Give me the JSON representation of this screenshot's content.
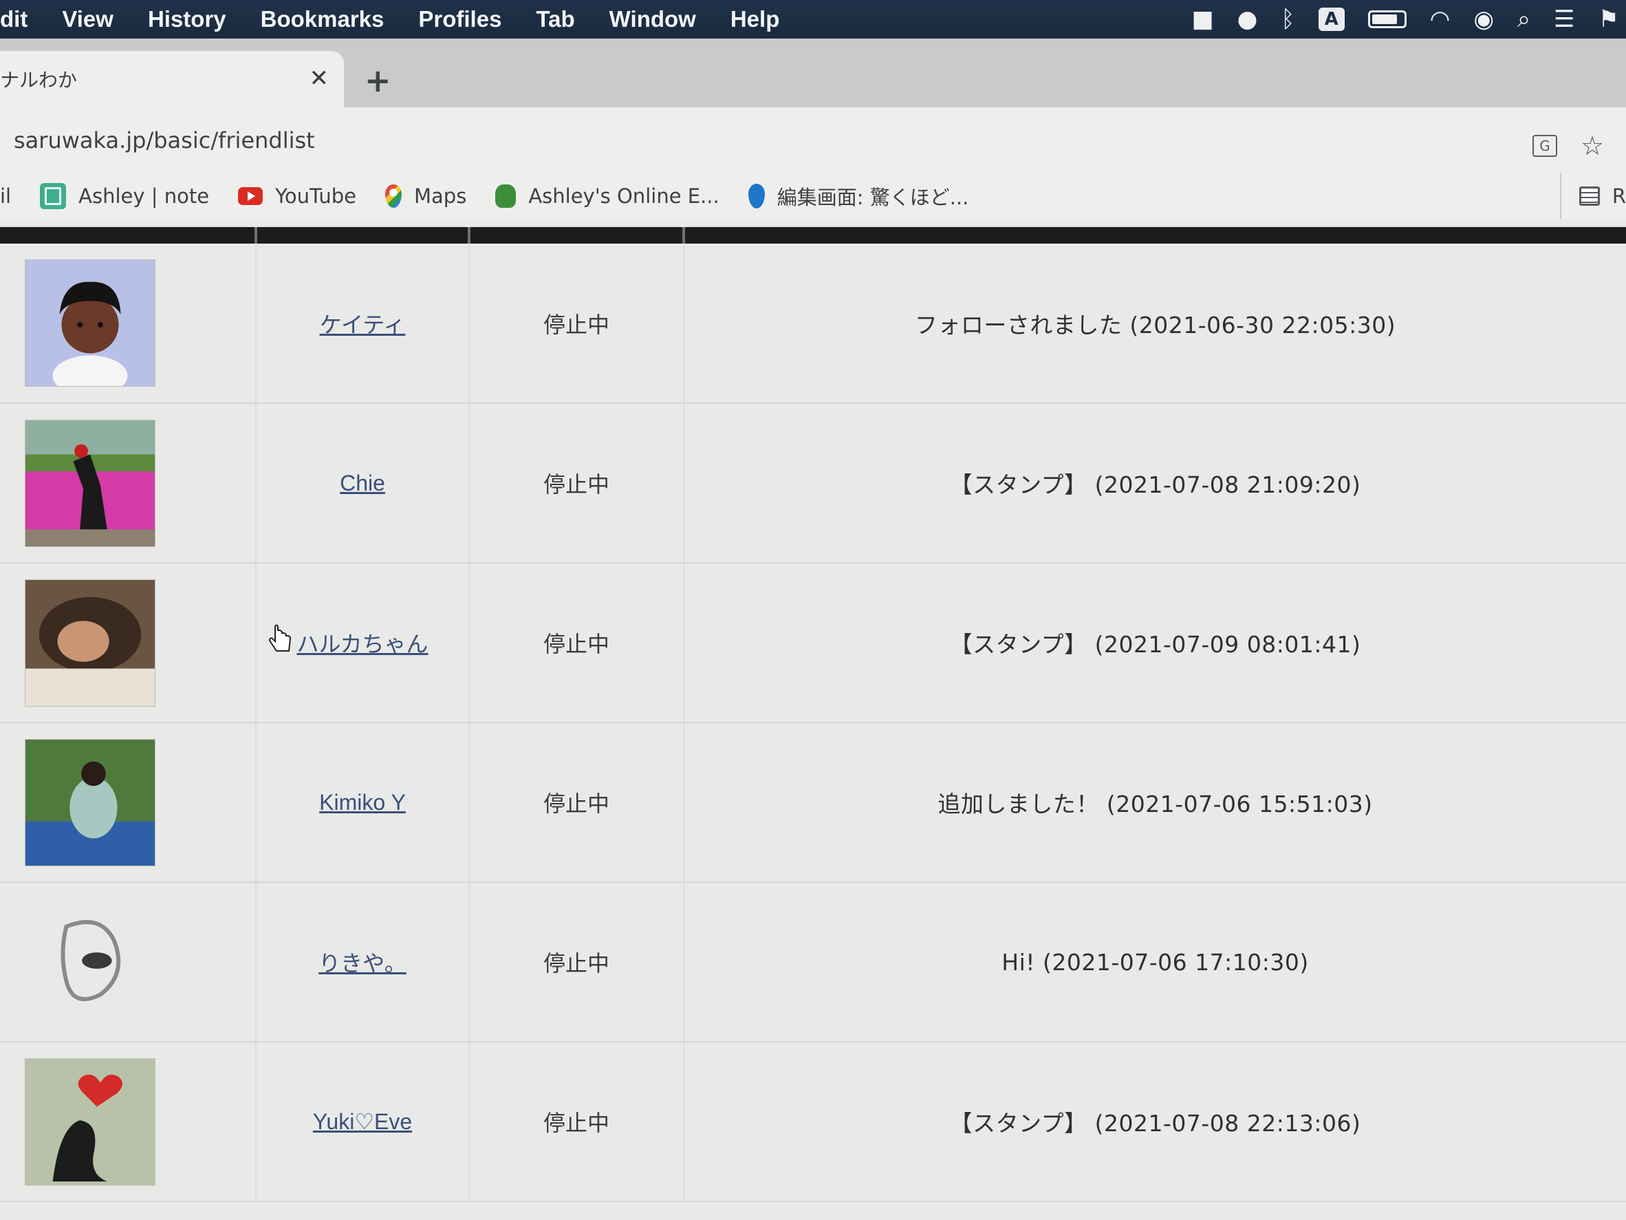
{
  "menubar": {
    "items": [
      "dit",
      "View",
      "History",
      "Bookmarks",
      "Profiles",
      "Tab",
      "Window",
      "Help"
    ],
    "status_box_letter": "A"
  },
  "tab": {
    "title": "ナルわか"
  },
  "omnibox": {
    "url": "saruwaka.jp/basic/friendlist"
  },
  "bookmarks": {
    "partial_left": "il",
    "items": [
      {
        "label": "Ashley | note",
        "icon": "note-icon"
      },
      {
        "label": "YouTube",
        "icon": "youtube-icon"
      },
      {
        "label": "Maps",
        "icon": "maps-icon"
      },
      {
        "label": "Ashley's Online E...",
        "icon": "frog-icon"
      },
      {
        "label": "編集画面: 驚くほど...",
        "icon": "pin-icon"
      }
    ],
    "reading_list_label": "R"
  },
  "friends": [
    {
      "name": "ケイティ",
      "status": "停止中",
      "message": "フォローされました (2021-06-30 22:05:30)"
    },
    {
      "name": "Chie",
      "status": "停止中",
      "message": "【スタンプ】 (2021-07-08 21:09:20)"
    },
    {
      "name": "ハルカちゃん",
      "status": "停止中",
      "message": "【スタンプ】 (2021-07-09 08:01:41)"
    },
    {
      "name": "Kimiko Y",
      "status": "停止中",
      "message": "追加しました！ (2021-07-06 15:51:03)"
    },
    {
      "name": "りきや。",
      "status": "停止中",
      "message": "Hi! (2021-07-06 17:10:30)"
    },
    {
      "name": "Yuki♡Eve",
      "status": "停止中",
      "message": "【スタンプ】 (2021-07-08 22:13:06)"
    }
  ]
}
